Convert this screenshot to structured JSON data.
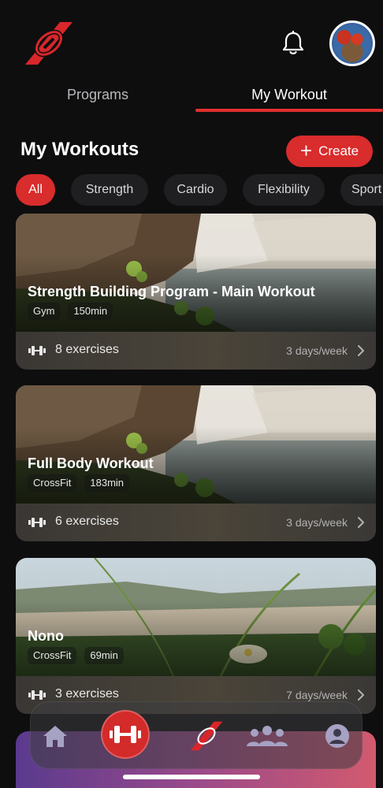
{
  "header": {
    "logo_icon": "brand-logo-icon",
    "notification_icon": "bell-icon",
    "avatar_icon": "user-avatar"
  },
  "tabs": [
    {
      "label": "Programs",
      "active": false
    },
    {
      "label": "My Workout",
      "active": true
    }
  ],
  "section": {
    "title": "My Workouts",
    "create_label": "Create"
  },
  "filters": [
    {
      "label": "All",
      "active": true
    },
    {
      "label": "Strength",
      "active": false
    },
    {
      "label": "Cardio",
      "active": false
    },
    {
      "label": "Flexibility",
      "active": false
    },
    {
      "label": "Sport",
      "active": false
    }
  ],
  "workouts": [
    {
      "title": "Strength Building Program - Main Workout",
      "type": "Gym",
      "duration": "150min",
      "exercises": "8 exercises",
      "frequency": "3 days/week",
      "image": "waterfall"
    },
    {
      "title": "Full Body Workout",
      "type": "CrossFit",
      "duration": "183min",
      "exercises": "6 exercises",
      "frequency": "3 days/week",
      "image": "waterfall"
    },
    {
      "title": "Nono",
      "type": "CrossFit",
      "duration": "69min",
      "exercises": "3 exercises",
      "frequency": "7 days/week",
      "image": "beach-plants"
    }
  ],
  "bottom_nav": [
    {
      "icon": "home-icon",
      "active": false
    },
    {
      "icon": "dumbbell-icon",
      "active": true
    },
    {
      "icon": "brand-logo-icon",
      "active": false
    },
    {
      "icon": "group-icon",
      "active": false
    },
    {
      "icon": "profile-icon",
      "active": false
    }
  ],
  "colors": {
    "accent": "#d92c2c",
    "background": "#0e0e0f",
    "chip_bg": "#1f1f22"
  }
}
